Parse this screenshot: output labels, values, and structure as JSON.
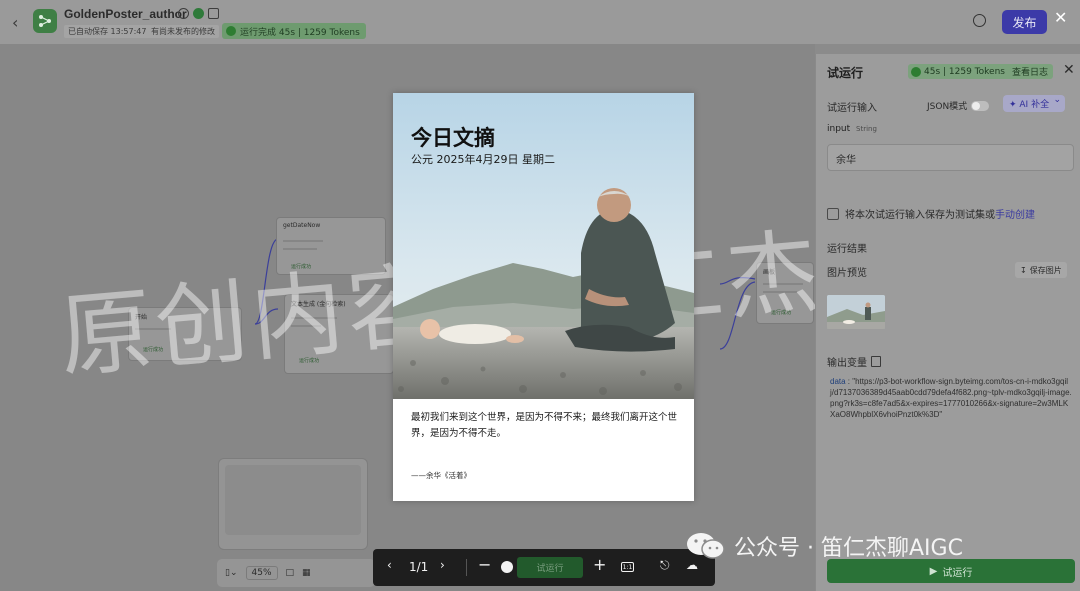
{
  "topbar": {
    "app_name": "GoldenPoster_author",
    "saved_at": "已自动保存 13:57:47",
    "unpublished": "有尚未发布的修改",
    "run_status": "运行完成 45s | 1259 Tokens",
    "publish_label": "发布",
    "close_glyph": "✕"
  },
  "canvas": {
    "nodes": [
      {
        "title": "getDateNow",
        "badge": "运行成功"
      },
      {
        "title": "开始",
        "badge": "运行成功"
      },
      {
        "title": "文本生成 (金句检索)",
        "badge": "运行成功"
      },
      {
        "title": "画板",
        "badge": "运行成功"
      }
    ],
    "zoom": "45%"
  },
  "watermark": "原创内容 BY 仁杰",
  "panel": {
    "title": "试运行",
    "status": "45s | 1259 Tokens",
    "view_log": "查看日志",
    "close_glyph": "✕",
    "trial_input": "试运行输入",
    "json_mode": "JSON模式",
    "ai_fill": "✦ AI 补全",
    "input_key": "input",
    "input_type": "String",
    "input_value": "余华",
    "save_as_test": "将本次试运行输入保存为测试集或",
    "manual_create": "手动创建",
    "run_result": "运行结果",
    "image_preview": "图片预览",
    "save_image": "保存图片",
    "output_vars": "输出变量",
    "output_key": "data",
    "output_value": "\"https://p3-bot-workflow-sign.byteimg.com/tos-cn-i-mdko3gqilj/d7137036389d45aab0cdd79defa4f682.png~tplv-mdko3gqilj-image.png?rk3s=c8fe7ad5&x-expires=1777010266&x-signature=2w3MLKXaO8WhpblX6vhoiPnzt0k%3D\"",
    "run_button": "试运行"
  },
  "poster": {
    "title": "今日文摘",
    "date": "公元 2025年4月29日 星期二",
    "quote": "最初我们来到这个世界，是因为不得不来；最终我们离开这个世界，是因为不得不走。",
    "author": "——余华《活着》"
  },
  "viewer": {
    "page": "1/1",
    "ghost_run": "试运行",
    "one_to_one": "1:1"
  },
  "wechat": {
    "text": "公众号 · 笛仁杰聊AIGC"
  }
}
